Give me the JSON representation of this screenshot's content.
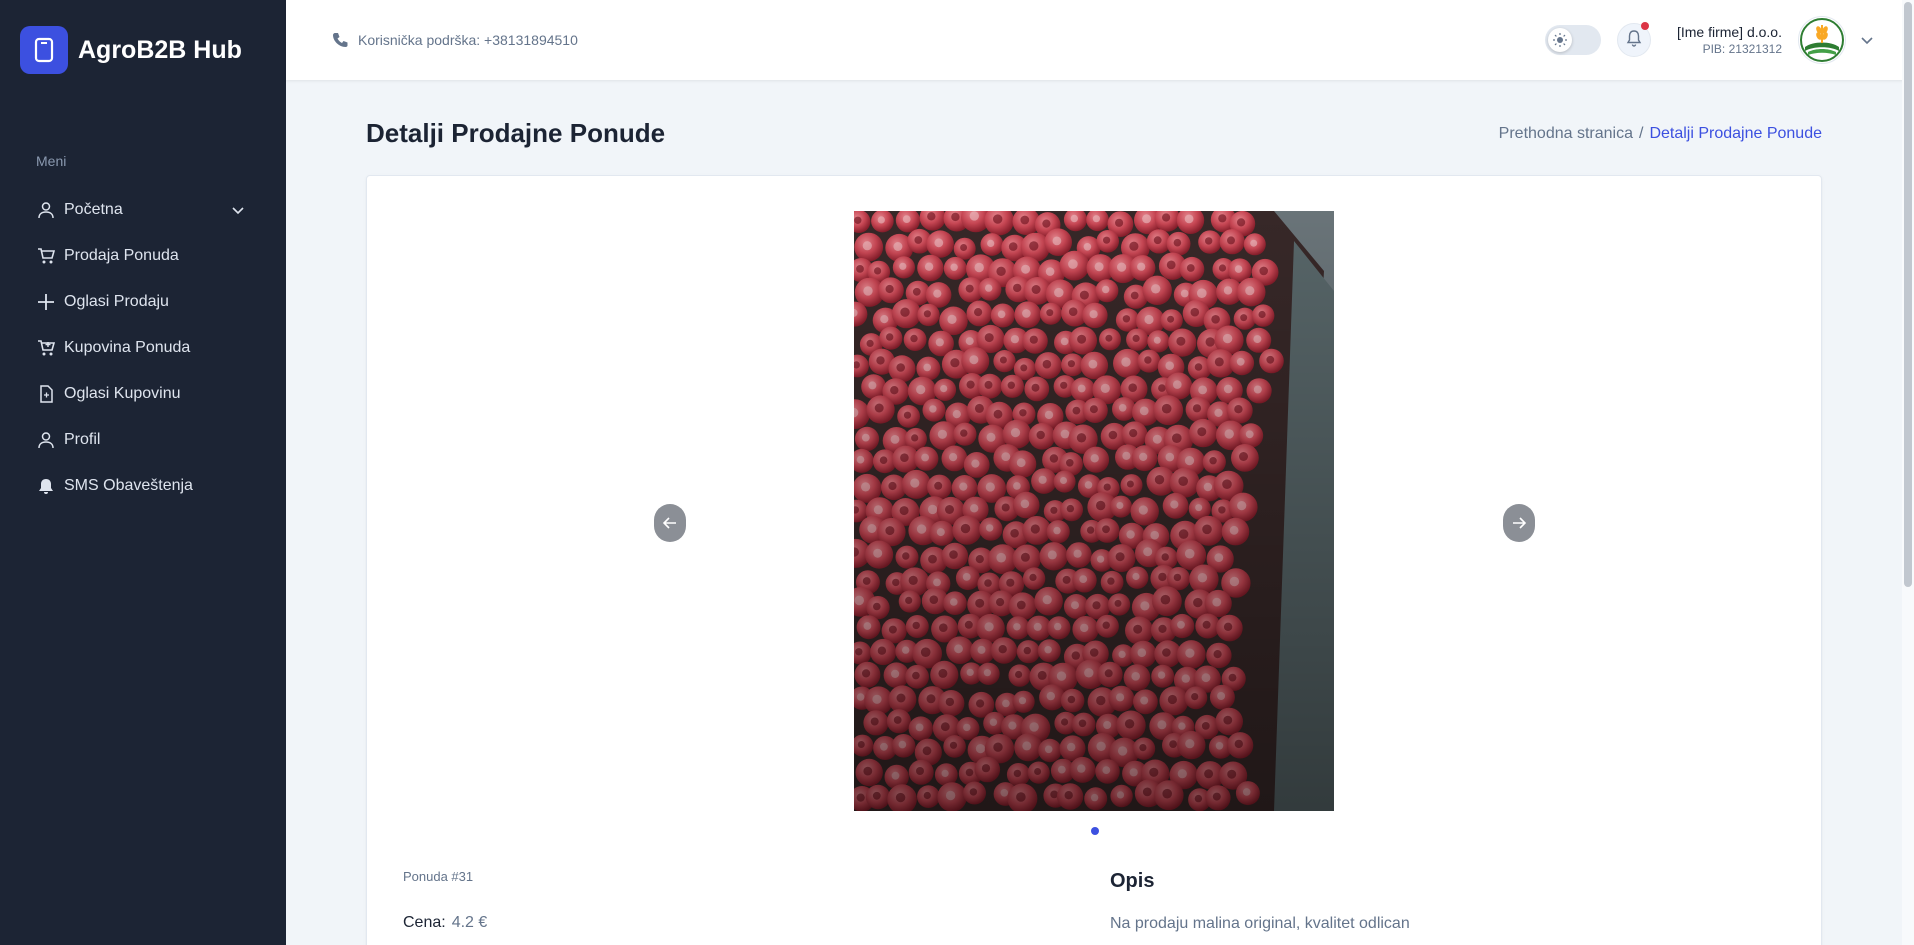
{
  "app": {
    "name": "AgroB2B Hub"
  },
  "sidebar": {
    "menu_title": "Meni",
    "items": [
      {
        "label": "Početna",
        "icon": "user-icon",
        "has_submenu": true
      },
      {
        "label": "Prodaja Ponuda",
        "icon": "cart-icon"
      },
      {
        "label": "Oglasi Prodaju",
        "icon": "plus-icon"
      },
      {
        "label": "Kupovina Ponuda",
        "icon": "cart-plus-icon"
      },
      {
        "label": "Oglasi Kupovinu",
        "icon": "document-icon"
      },
      {
        "label": "Profil",
        "icon": "user-icon"
      },
      {
        "label": "SMS Obaveštenja",
        "icon": "bell-icon"
      }
    ]
  },
  "header": {
    "support_text": "Korisnička podrška: +38131894510",
    "company_name": "[Ime firme] d.o.o.",
    "company_pib": "PIB: 21321312"
  },
  "page": {
    "title": "Detalji Prodajne Ponude",
    "breadcrumb": {
      "previous": "Prethodna stranica",
      "separator": "/",
      "current": "Detalji Prodajne Ponude"
    }
  },
  "offer": {
    "id_label": "Ponuda #31",
    "price_label": "Cena:",
    "price_value": "4.2 €",
    "description_title": "Opis",
    "description_text": "Na prodaju malina original, kvalitet odlican",
    "image_subject": "raspberries-photo"
  },
  "colors": {
    "sidebar_bg": "#1c2434",
    "accent": "#3c50e0",
    "page_bg": "#f1f5f9",
    "notification_dot": "#dc3545"
  }
}
